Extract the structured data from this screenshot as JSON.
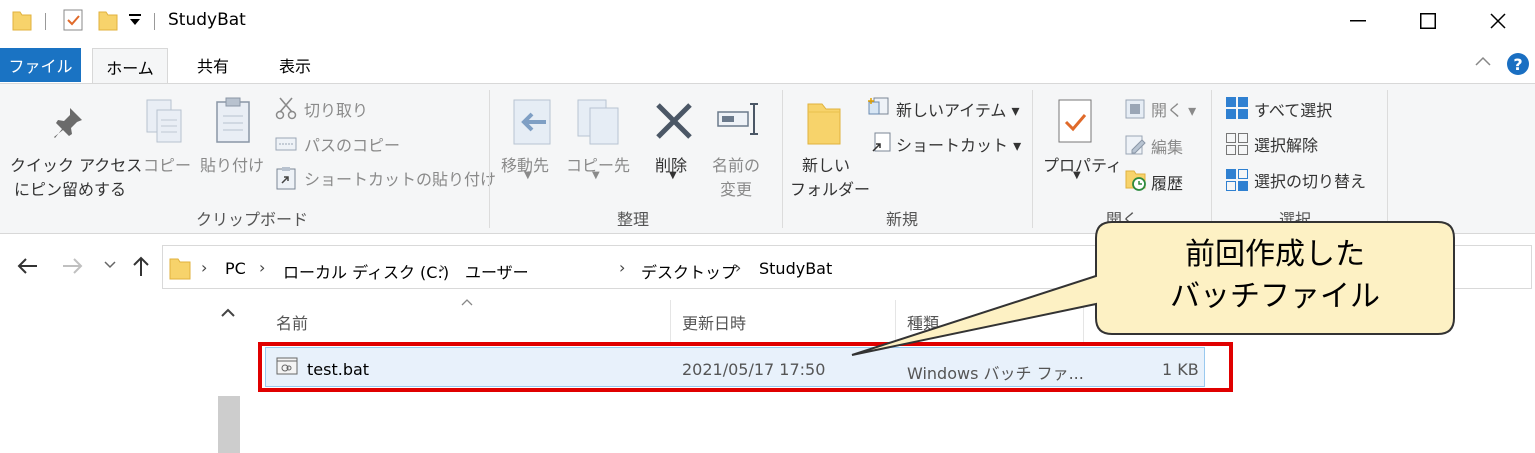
{
  "window": {
    "title": "StudyBat",
    "minimize": "minimize",
    "maximize": "maximize",
    "close": "close"
  },
  "ribbon_tabs": [
    "ファイル",
    "ホーム",
    "共有",
    "表示"
  ],
  "clipboard": {
    "pin_line1": "クイック アクセス",
    "pin_line2": "にピン留めする",
    "copy": "コピー",
    "paste": "貼り付け",
    "cut": "切り取り",
    "copy_path": "パスのコピー",
    "paste_shortcut": "ショートカットの貼り付け",
    "group": "クリップボード"
  },
  "organize": {
    "move_to": "移動先",
    "copy_to": "コピー先",
    "delete": "削除",
    "rename_line1": "名前の",
    "rename_line2": "変更",
    "group": "整理"
  },
  "new": {
    "new_folder_line1": "新しい",
    "new_folder_line2": "フォルダー",
    "new_item": "新しいアイテム ▾",
    "shortcut": "ショートカット ▾",
    "group": "新規"
  },
  "open": {
    "properties": "プロパティ",
    "open": "開く ▾",
    "edit": "編集",
    "history": "履歴",
    "group": "開く"
  },
  "select": {
    "select_all": "すべて選択",
    "select_none": "選択解除",
    "invert": "選択の切り替え",
    "group": "選択"
  },
  "address": {
    "crumbs": [
      "PC",
      "ローカル ディスク (C:)",
      "ユーザー",
      "デスクトップ",
      "StudyBat"
    ]
  },
  "columns": {
    "name": "名前",
    "modified": "更新日時",
    "type": "種類"
  },
  "files": [
    {
      "name": "test.bat",
      "modified": "2021/05/17 17:50",
      "type": "Windows バッチ ファ...",
      "size": "1 KB"
    }
  ],
  "callout": {
    "line1": "前回作成した",
    "line2": "バッチファイル"
  },
  "colors": {
    "file_tab": "#1a73c3",
    "highlight": "#e00000",
    "callout_fill": "#fdf1c4",
    "callout_border": "#333333"
  }
}
